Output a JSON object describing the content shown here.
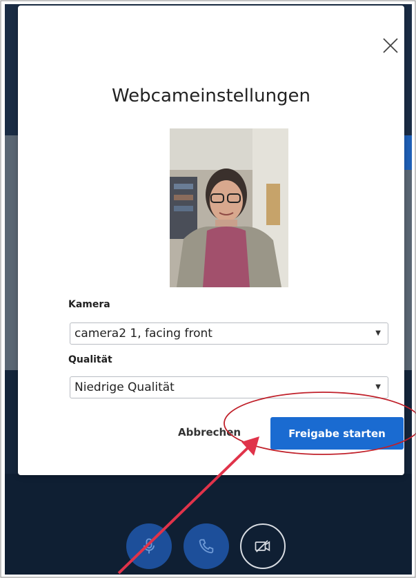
{
  "dialog": {
    "title": "Webcameinstellungen",
    "close_icon": "close-icon"
  },
  "camera": {
    "label": "Kamera",
    "selected": "camera2 1, facing front"
  },
  "quality": {
    "label": "Qualität",
    "selected": "Niedrige Qualität"
  },
  "actions": {
    "cancel_label": "Abbrechen",
    "start_label": "Freigabe starten"
  },
  "controls": {
    "mic_icon": "microphone-icon",
    "phone_icon": "phone-icon",
    "camera_icon": "camera-off-icon"
  },
  "colors": {
    "primary": "#1a6bd1",
    "annotation": "#c0202a",
    "arrow": "#e0334a"
  }
}
